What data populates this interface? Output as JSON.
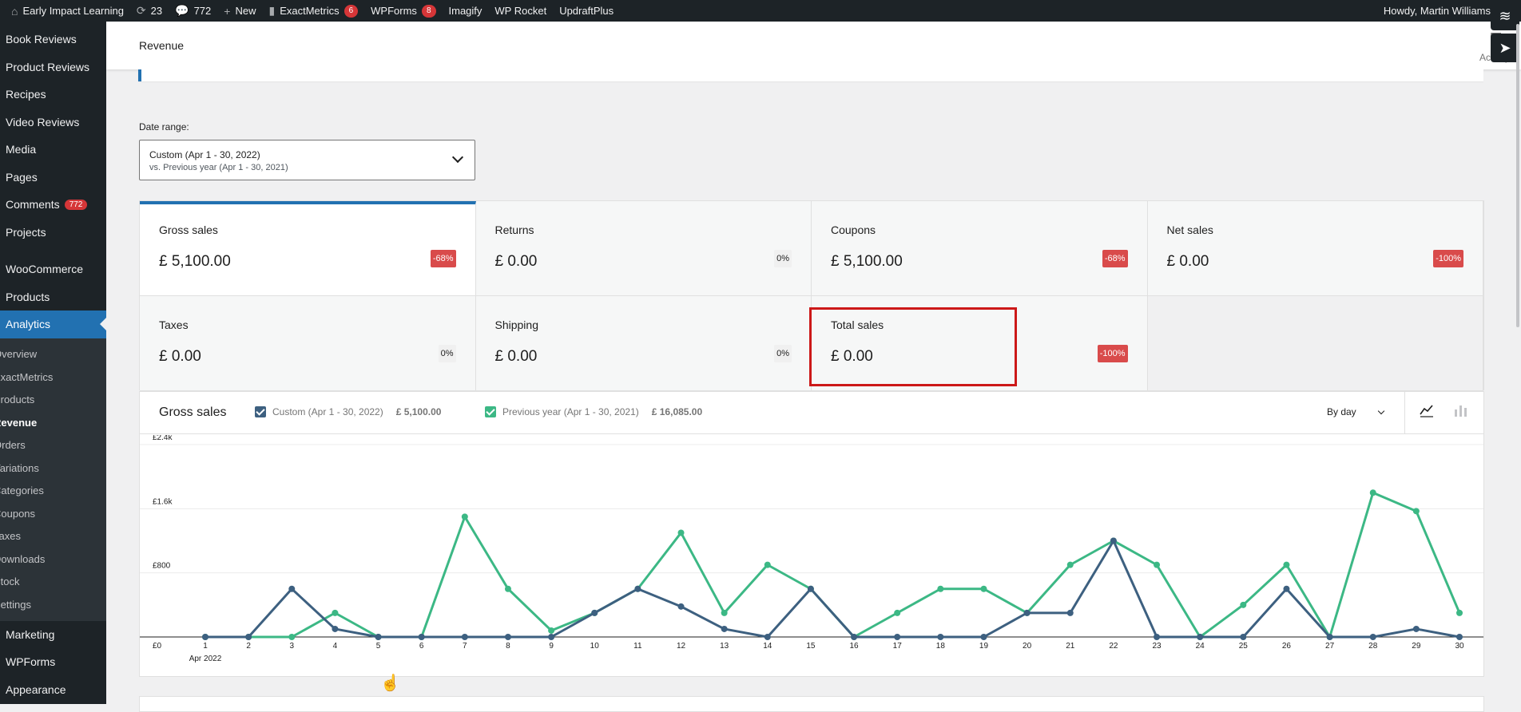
{
  "adminbar": {
    "site_name": "Early Impact Learning",
    "updates_count": "23",
    "comments_count": "772",
    "new_label": "New",
    "exactmetrics_label": "ExactMetrics",
    "exactmetrics_badge": "6",
    "wpforms_label": "WPForms",
    "wpforms_badge": "8",
    "imagify_label": "Imagify",
    "wprocket_label": "WP Rocket",
    "updraft_label": "UpdraftPlus",
    "howdy": "Howdy, Martin Williams"
  },
  "sidebar": {
    "items": [
      {
        "label": "Book Reviews"
      },
      {
        "label": "Product Reviews"
      },
      {
        "label": "Recipes"
      },
      {
        "label": "Video Reviews"
      },
      {
        "label": "Media"
      },
      {
        "label": "Pages"
      },
      {
        "label": "Comments",
        "badge": "772"
      },
      {
        "label": "Projects"
      },
      {
        "label": "WooCommerce"
      },
      {
        "label": "Products"
      },
      {
        "label": "Analytics"
      }
    ],
    "analytics_sub": [
      {
        "label": "Overview"
      },
      {
        "label": "ExactMetrics"
      },
      {
        "label": "Products"
      },
      {
        "label": "Revenue"
      },
      {
        "label": "Orders"
      },
      {
        "label": "Variations"
      },
      {
        "label": "Categories"
      },
      {
        "label": "Coupons"
      },
      {
        "label": "Taxes"
      },
      {
        "label": "Downloads"
      },
      {
        "label": "Stock"
      },
      {
        "label": "Settings"
      }
    ],
    "bottom_items": [
      {
        "label": "Marketing"
      },
      {
        "label": "WPForms"
      },
      {
        "label": "Appearance"
      }
    ]
  },
  "header": {
    "title": "Revenue",
    "activity_label": "Activity"
  },
  "date_range": {
    "label": "Date range:",
    "primary": "Custom (Apr 1 - 30, 2022)",
    "secondary": "vs. Previous year (Apr 1 - 30, 2021)"
  },
  "summary": [
    {
      "label": "Gross sales",
      "value": "£ 5,100.00",
      "delta": "-68%",
      "negative": true
    },
    {
      "label": "Returns",
      "value": "£ 0.00",
      "delta": "0%",
      "negative": false
    },
    {
      "label": "Coupons",
      "value": "£ 5,100.00",
      "delta": "-68%",
      "negative": true
    },
    {
      "label": "Net sales",
      "value": "£ 0.00",
      "delta": "-100%",
      "negative": true
    },
    {
      "label": "Taxes",
      "value": "£ 0.00",
      "delta": "0%",
      "negative": false
    },
    {
      "label": "Shipping",
      "value": "£ 0.00",
      "delta": "0%",
      "negative": false
    },
    {
      "label": "Total sales",
      "value": "£ 0.00",
      "delta": "-100%",
      "negative": true
    }
  ],
  "chart_panel": {
    "title": "Gross sales",
    "legend_current": "Custom (Apr 1 - 30, 2022)",
    "legend_current_total": "£ 5,100.00",
    "legend_previous": "Previous year (Apr 1 - 30, 2021)",
    "legend_previous_total": "£ 16,085.00",
    "interval": "By day"
  },
  "colors": {
    "current": "#3d6080",
    "previous": "#3cb885",
    "accent": "#2271b1",
    "negative_badge": "#d94b4b"
  },
  "chart_data": {
    "type": "line",
    "x": [
      "1",
      "2",
      "3",
      "4",
      "5",
      "6",
      "7",
      "8",
      "9",
      "10",
      "11",
      "12",
      "13",
      "14",
      "15",
      "16",
      "17",
      "18",
      "19",
      "20",
      "21",
      "22",
      "23",
      "24",
      "25",
      "26",
      "27",
      "28",
      "29",
      "30"
    ],
    "x_sublabel": "Apr 2022",
    "y_ticks": [
      "£0",
      "£800",
      "£1.6k",
      "£2.4k"
    ],
    "ylim": [
      0,
      2400
    ],
    "grid": true,
    "series": [
      {
        "name": "Custom (Apr 1 - 30, 2022)",
        "color": "#3d6080",
        "values": [
          0,
          0,
          600,
          100,
          0,
          0,
          0,
          0,
          0,
          300,
          600,
          380,
          100,
          0,
          600,
          0,
          0,
          0,
          0,
          300,
          300,
          1200,
          0,
          0,
          0,
          600,
          0,
          0,
          100,
          0
        ]
      },
      {
        "name": "Previous year (Apr 1 - 30, 2021)",
        "color": "#3cb885",
        "values": [
          0,
          0,
          0,
          300,
          0,
          0,
          1500,
          600,
          80,
          300,
          600,
          1300,
          300,
          900,
          600,
          0,
          300,
          600,
          600,
          300,
          900,
          1200,
          900,
          0,
          400,
          900,
          0,
          1800,
          1570,
          300
        ]
      }
    ]
  }
}
